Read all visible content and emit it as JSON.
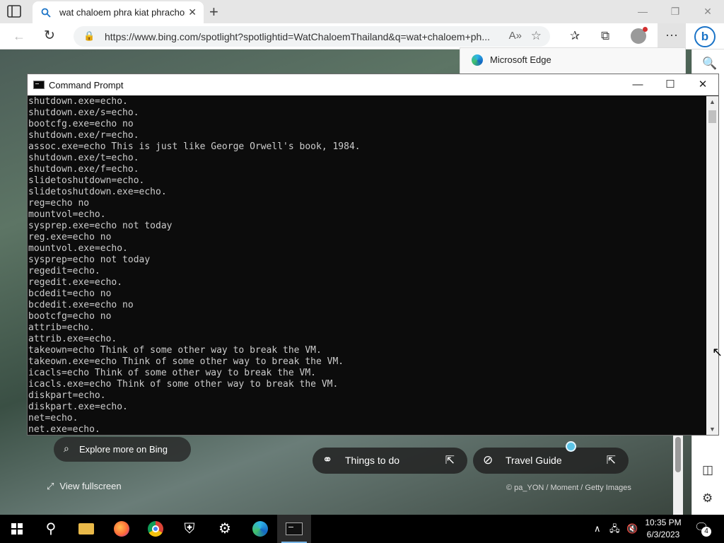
{
  "browser": {
    "tab_title": "wat chaloem phra kiat phrachom",
    "url": "https://www.bing.com/spotlight?spotlightid=WatChaloemThailand&q=wat+chaloem+ph...",
    "popup_label": "Microsoft Edge",
    "icons": {
      "tab_actions": "tab-actions-icon",
      "search": "search-icon",
      "close": "close-icon",
      "new_tab": "plus-icon",
      "back": "back-arrow-icon",
      "refresh": "refresh-icon",
      "lock": "lock-icon",
      "read_aloud": "read-aloud-icon",
      "favorite_add": "star-plus-icon",
      "favorites": "favorites-icon",
      "collections": "collections-icon",
      "more": "more-icon",
      "bing": "bing-chat-icon"
    }
  },
  "page": {
    "explore_label": "Explore more on Bing",
    "fullscreen_label": "View fullscreen",
    "things_label": "Things to do",
    "travel_label": "Travel Guide",
    "credit": "© pa_YON / Moment / Getty Images"
  },
  "cmd": {
    "title": "Command Prompt",
    "lines": [
      "shutdown.exe=echo.",
      "shutdown.exe/s=echo.",
      "bootcfg.exe=echo no",
      "shutdown.exe/r=echo.",
      "assoc.exe=echo This is just like George Orwell's book, 1984.",
      "shutdown.exe/t=echo.",
      "shutdown.exe/f=echo.",
      "slidetoshutdown=echo.",
      "slidetoshutdown.exe=echo.",
      "reg=echo no",
      "mountvol=echo.",
      "sysprep.exe=echo not today",
      "reg.exe=echo no",
      "mountvol.exe=echo.",
      "sysprep=echo not today",
      "regedit=echo.",
      "regedit.exe=echo.",
      "bcdedit=echo no",
      "bcdedit.exe=echo no",
      "bootcfg=echo no",
      "attrib=echo.",
      "attrib.exe=echo.",
      "takeown=echo Think of some other way to break the VM.",
      "takeown.exe=echo Think of some other way to break the VM.",
      "icacls=echo Think of some other way to break the VM.",
      "icacls.exe=echo Think of some other way to break the VM.",
      "diskpart=echo.",
      "diskpart.exe=echo.",
      "net=echo.",
      "net.exe=echo."
    ]
  },
  "taskbar": {
    "time": "10:35 PM",
    "date": "6/3/2023",
    "notification_count": "4"
  }
}
